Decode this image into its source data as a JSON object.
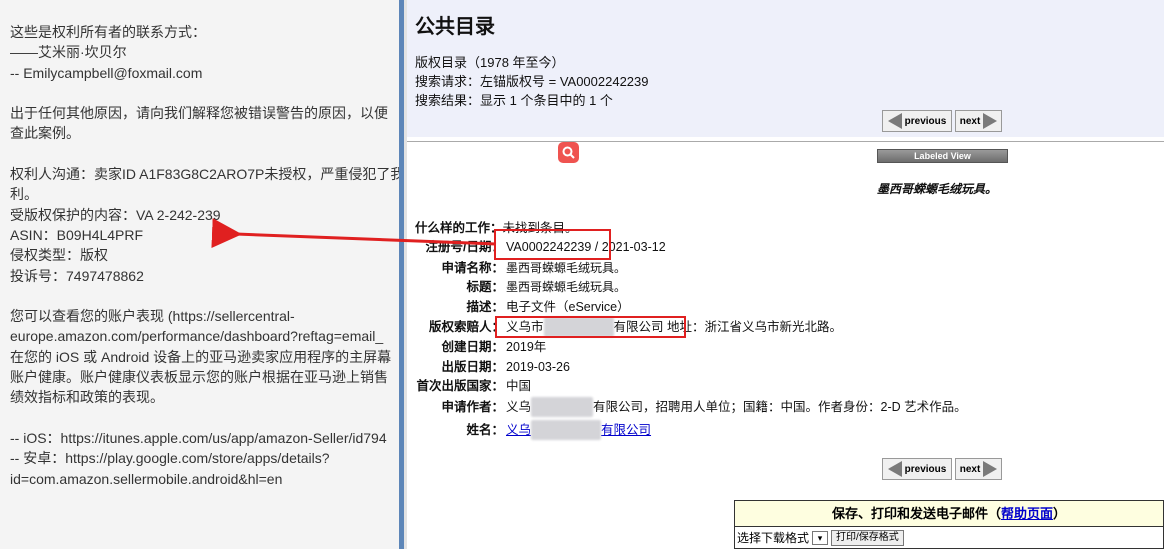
{
  "left_message": {
    "lines": [
      "这些是权利所有者的联系方式：",
      "——艾米丽·坎贝尔",
      "-- Emilycampbell@foxmail.com",
      "",
      "出于任何其他原因，请向我们解释您被错误警告的原因，以便",
      "查此案例。",
      "",
      "权利人沟通：卖家ID A1F83G8C2ARO7P未授权，严重侵犯了我",
      "利。",
      "受版权保护的内容：VA 2-242-239",
      "ASIN：B09H4L4PRF",
      "侵权类型：版权",
      "投诉号：7497478862",
      "",
      "您可以查看您的账户表现 (https://sellercentral-",
      "europe.amazon.com/performance/dashboard?reftag=email_",
      "在您的 iOS 或 Android 设备上的亚马逊卖家应用程序的主屏幕",
      "账户健康。账户健康仪表板显示您的账户根据在亚马逊上销售",
      "绩效指标和政策的表现。",
      "",
      "-- iOS：https://itunes.apple.com/us/app/amazon-Seller/id794",
      "-- 安卓：https://play.google.com/store/apps/details?",
      "id=com.amazon.sellermobile.android&hl=en"
    ]
  },
  "catalog": {
    "title": "公共目录",
    "catalog_name": "版权目录（1978 年至今）",
    "search_request": "搜索请求：左锚版权号 = VA0002242239",
    "search_result": "搜索结果：显示 1 个条目中的 1 个",
    "previous_label": "previous",
    "next_label": "next",
    "labeled_view": "Labeled View",
    "work_title": "墨西哥蝾螈毛绒玩具。",
    "fields": {
      "type_label": "什么样的工作：",
      "type_value": "未找到条目。",
      "reg_label": "注册号/日期：",
      "reg_number": "VA0002242239",
      "reg_date": "/ 2021-03-12",
      "app_title_label": "申请名称：",
      "app_title_value": "墨西哥蝾螈毛绒玩具。",
      "title_label": "标题：",
      "title_value": "墨西哥蝾螈毛绒玩具。",
      "desc_label": "描述：",
      "desc_value": "电子文件（eService）",
      "claimant_label": "版权索赔人：",
      "claimant_prefix": "义乌市",
      "claimant_suffix": "有限公司",
      "claimant_addr_label": "地址：",
      "claimant_addr": "浙江省义乌市新光北路。",
      "created_label": "创建日期：",
      "created_value": "2019年",
      "published_label": "出版日期：",
      "published_value": "2019-03-26",
      "nation_label": "首次出版国家：",
      "nation_value": "中国",
      "author_label": "申请作者：",
      "author_prefix": "义乌",
      "author_suffix": "有限公司，招聘用人单位；国籍：中国。作者身份：2-D 艺术作品。",
      "name_label": "姓名：",
      "name_prefix": "义乌",
      "name_suffix": "有限公司"
    },
    "save": {
      "header": "保存、打印和发送电子邮件（",
      "help_link": "帮助页面",
      "header_end": "）",
      "format_label": "选择下载格式",
      "print_button": "打印/保存格式"
    }
  },
  "colors": {
    "annotation_red": "#e02020",
    "divider_blue": "#5d86b8",
    "search_icon": "#ef5350"
  }
}
